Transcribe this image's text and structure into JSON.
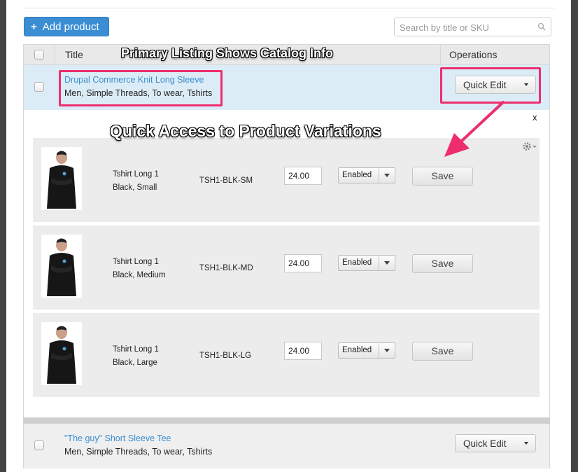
{
  "toolbar": {
    "add_icon": "plus-icon",
    "add_label": "Add product",
    "search_placeholder": "Search by title or SKU",
    "search_icon": "magnifier-icon"
  },
  "table": {
    "col_title": "Title",
    "col_operations": "Operations"
  },
  "products": [
    {
      "title": "Drupal Commerce Knit Long Sleeve",
      "categories": "Men, Simple Threads, To wear, Tshirts",
      "operation": "Quick Edit"
    },
    {
      "title": "\"The guy\" Short Sleeve Tee",
      "categories": "Men, Simple Threads, To wear, Tshirts",
      "operation": "Quick Edit"
    }
  ],
  "quick_edit": {
    "close_label": "x",
    "variations": [
      {
        "name": "Tshirt Long 1",
        "attributes": "Black, Small",
        "sku": "TSH1-BLK-SM",
        "price": "24.00",
        "status": "Enabled",
        "save_label": "Save"
      },
      {
        "name": "Tshirt Long 1",
        "attributes": "Black, Medium",
        "sku": "TSH1-BLK-MD",
        "price": "24.00",
        "status": "Enabled",
        "save_label": "Save"
      },
      {
        "name": "Tshirt Long 1",
        "attributes": "Black, Large",
        "sku": "TSH1-BLK-LG",
        "price": "24.00",
        "status": "Enabled",
        "save_label": "Save"
      }
    ]
  },
  "annotations": {
    "primary": "Primary Listing Shows Catalog Info",
    "variations": "Quick Access to Product Variations",
    "highlight_color": "#ee2d6e"
  },
  "colors": {
    "accent": "#3c8ed4",
    "link": "#3a8ed0",
    "selected_row": "#dcecf6"
  }
}
